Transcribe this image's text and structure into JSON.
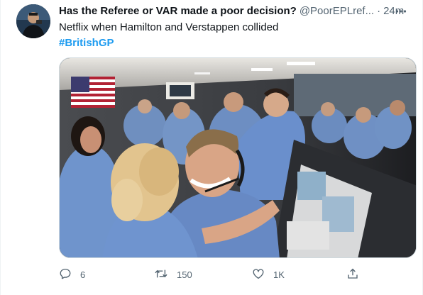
{
  "tweet": {
    "display_name": "Has the Referee or VAR made a poor decision?",
    "handle": "@PoorEPLref...",
    "separator": "·",
    "time": "24m",
    "text": "Netflix when Hamilton and Verstappen collided",
    "hashtag": "#BritishGP",
    "media_alt": "Mission control room celebration photo",
    "stats": {
      "replies": "6",
      "retweets": "150",
      "likes": "1K"
    }
  },
  "colors": {
    "text": "#0f1419",
    "secondary": "#536471",
    "link": "#1d9bf0",
    "border": "#cfd9de"
  },
  "icons": {
    "more": "more-icon",
    "reply": "reply-icon",
    "retweet": "retweet-icon",
    "like": "like-icon",
    "share": "share-icon"
  }
}
